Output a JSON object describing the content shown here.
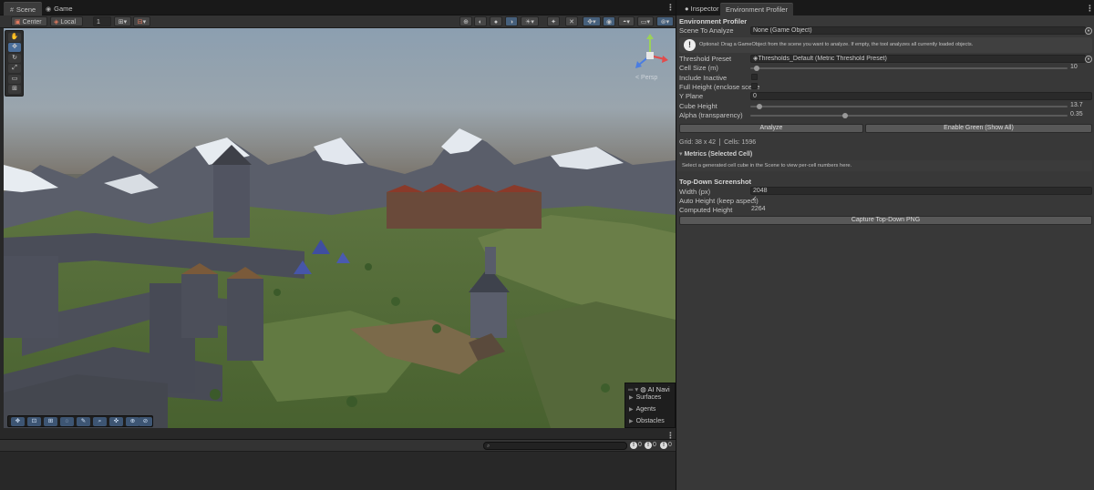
{
  "scene_window": {
    "tabs": [
      {
        "label": "Scene",
        "icon": "grid-icon"
      },
      {
        "label": "Game",
        "icon": "gamepad-icon"
      }
    ],
    "toolbar": {
      "pivot_label": "Center",
      "space_label": "Local",
      "grid_size_value": "1"
    },
    "persp_label": "< Persp",
    "ai_navigation": {
      "title": "AI Navi",
      "items": [
        "Surfaces",
        "Agents",
        "Obstacles"
      ]
    }
  },
  "console": {
    "search_placeholder": "",
    "counts": {
      "info": "0",
      "warnings": "0",
      "errors": "0"
    }
  },
  "inspector": {
    "tabs": [
      {
        "label": "Inspector",
        "icon": "info-icon"
      },
      {
        "label": "Environment Profiler"
      }
    ],
    "panel_title": "Environment Profiler",
    "scene_to_analyze": {
      "label": "Scene To Analyze",
      "value": "None (Game Object)"
    },
    "help_text": "Optional: Drag a GameObject from the scene you want to analyze. If empty, the tool analyzes all currently loaded objects.",
    "threshold_preset": {
      "label": "Threshold Preset",
      "value": "Thresholds_Default (Metric Threshold Preset)"
    },
    "cell_size": {
      "label": "Cell Size (m)",
      "value": "10",
      "fraction": 0.02
    },
    "include_inactive": {
      "label": "Include Inactive",
      "checked": false
    },
    "full_height": {
      "label": "Full Height (enclose scene",
      "checked": false
    },
    "y_plane": {
      "label": "Y Plane",
      "value": "0"
    },
    "cube_height": {
      "label": "Cube Height",
      "value": "13.7",
      "fraction": 0.03
    },
    "alpha": {
      "label": "Alpha (transparency)",
      "value": "0.35",
      "fraction": 0.3
    },
    "analyze_button": "Analyze",
    "enable_green_button": "Enable Green (Show All)",
    "grid_stat": "Grid: 38 x 42",
    "cells_stat": "Cells: 1596",
    "metrics_foldout": "Metrics (Selected Cell)",
    "metrics_note": "Select a generated cell cube in the Scene to view per-cell numbers here.",
    "top_down": {
      "title": "Top-Down Screenshot",
      "width_label": "Width (px)",
      "width_value": "2048",
      "auto_height_label": "Auto Height (keep aspect)",
      "auto_height_checked": true,
      "computed_height_label": "Computed Height",
      "computed_height_value": "2264",
      "capture_button": "Capture Top-Down PNG"
    }
  }
}
